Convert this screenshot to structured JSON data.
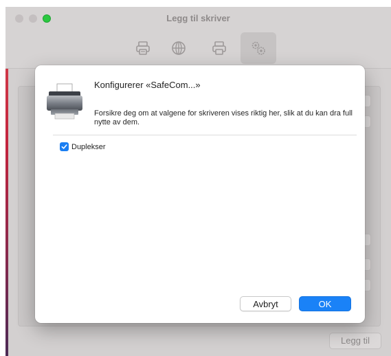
{
  "window": {
    "title": "Legg til skriver",
    "toolbar": [
      "default-printer-icon",
      "ip-globe-icon",
      "windows-printer-icon",
      "advanced-gears-icon"
    ],
    "add_button_label": "Legg til"
  },
  "sheet": {
    "title": "Konfigurerer «SafeCom...»",
    "description": "Forsikre deg om at valgene for skriveren vises riktig her, slik at du kan dra full nytte av dem.",
    "options": [
      {
        "label": "Duplekser",
        "checked": true
      }
    ],
    "cancel_label": "Avbryt",
    "ok_label": "OK"
  },
  "colors": {
    "accent": "#1a82f7",
    "checkbox": "#1a7ef2",
    "traffic_green": "#2bc840"
  }
}
